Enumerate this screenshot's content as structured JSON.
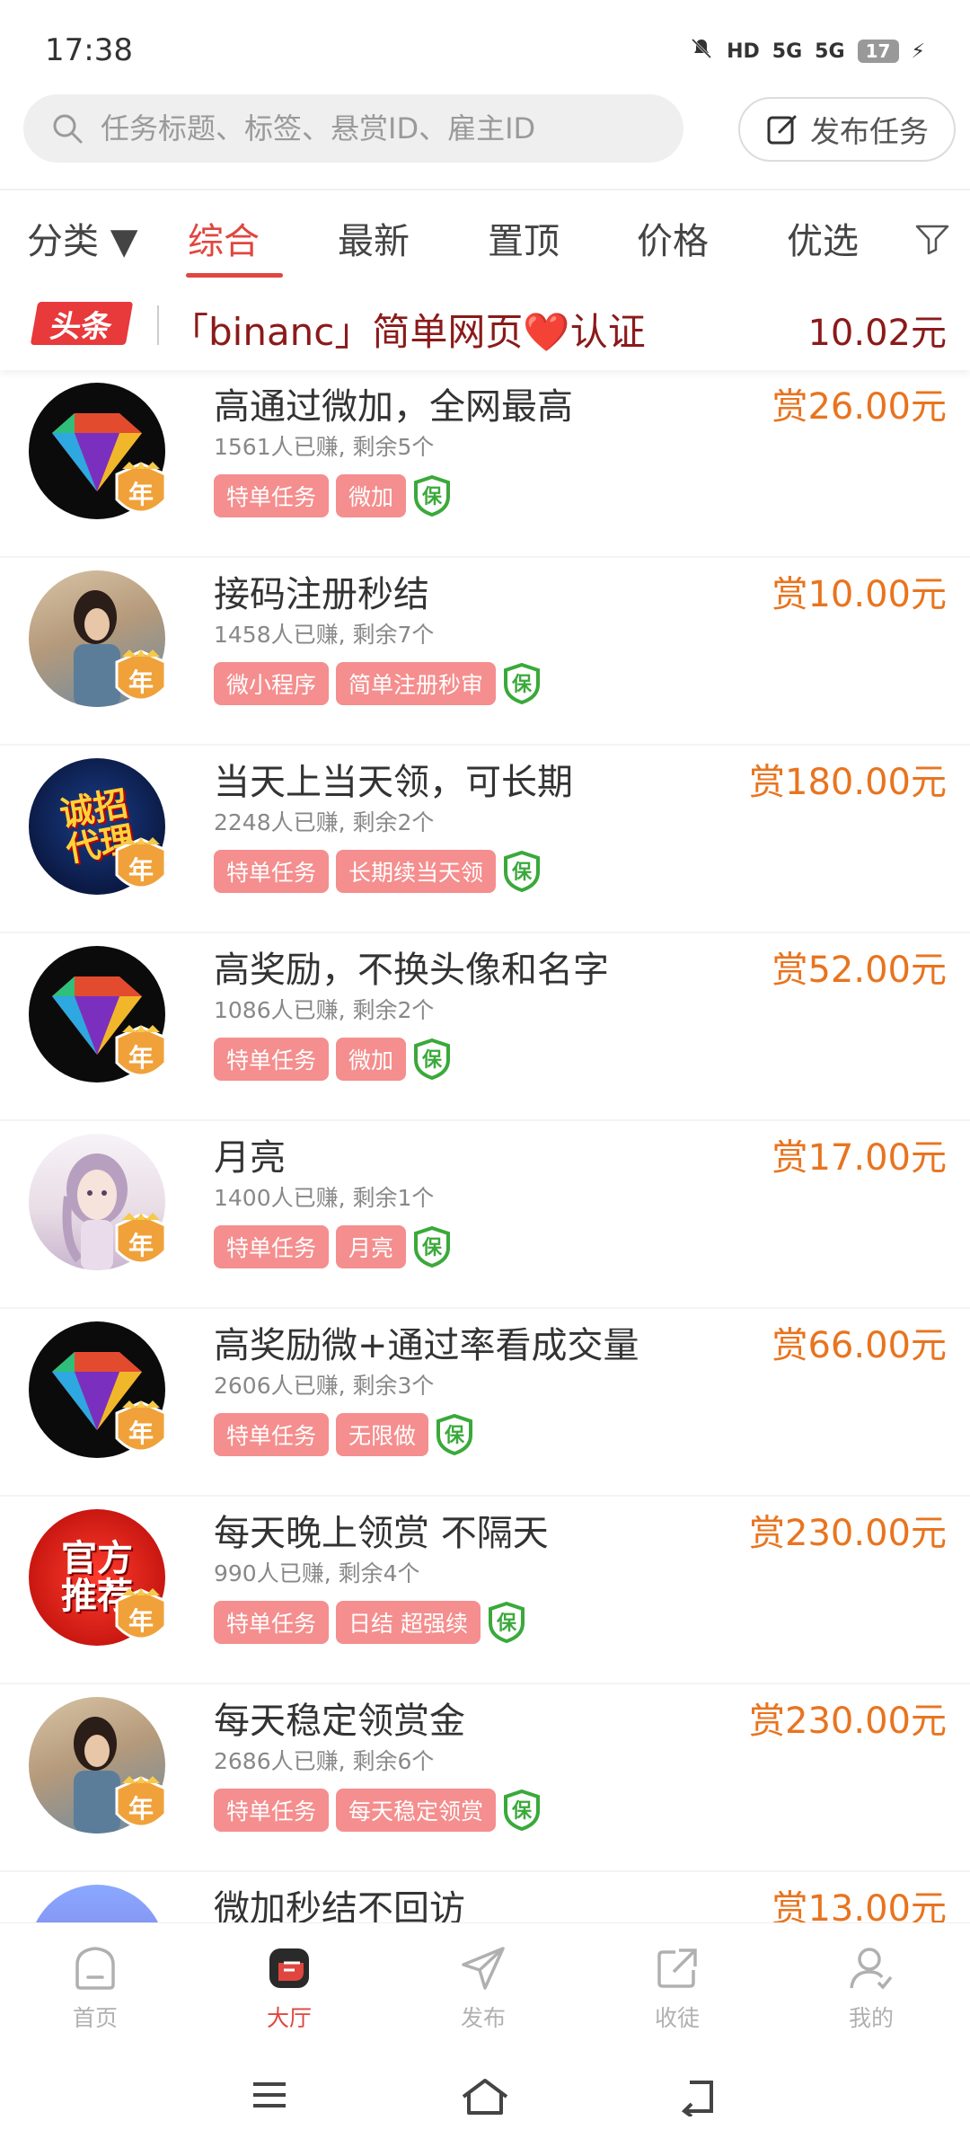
{
  "status_bar": {
    "time": "17:38",
    "icons": [
      "mute-icon",
      "hd-icon",
      "5g-signal-icon",
      "5g-signal-icon"
    ],
    "hd_label": "HD",
    "net1": "5G",
    "net2": "5G",
    "battery": "17"
  },
  "search": {
    "placeholder": "任务标题、标签、悬赏ID、雇主ID"
  },
  "publish_button": {
    "label": "发布任务"
  },
  "tabs": {
    "category": "分类 ▼",
    "items": [
      "综合",
      "最新",
      "置顶",
      "价格",
      "优选"
    ],
    "active": "综合"
  },
  "headline": {
    "badge": "头条",
    "text": "「binanc」简单网页❤️认证",
    "price": "10.02元"
  },
  "tasks": [
    {
      "title": "高通过微加，全网最高",
      "meta": "1561人已赚, 剩余5个",
      "tags": [
        "特单任务",
        "微加"
      ],
      "reward": "赏26.00元",
      "avatar": "diamond"
    },
    {
      "title": "接码注册秒结",
      "meta": "1458人已赚, 剩余7个",
      "tags": [
        "微小程序",
        "简单注册秒审"
      ],
      "reward": "赏10.00元",
      "avatar": "girl"
    },
    {
      "title": "当天上当天领，可长期",
      "meta": "2248人已赚, 剩余2个",
      "tags": [
        "特单任务",
        "长期续当天领"
      ],
      "reward": "赏180.00元",
      "avatar": "agent",
      "avatar_text": "诚招代理"
    },
    {
      "title": "高奖励，不换头像和名字",
      "meta": "1086人已赚, 剩余2个",
      "tags": [
        "特单任务",
        "微加"
      ],
      "reward": "赏52.00元",
      "avatar": "diamond"
    },
    {
      "title": "月亮",
      "meta": "1400人已赚, 剩余1个",
      "tags": [
        "特单任务",
        "月亮"
      ],
      "reward": "赏17.00元",
      "avatar": "anime"
    },
    {
      "title": "高奖励微+通过率看成交量",
      "meta": "2606人已赚, 剩余3个",
      "tags": [
        "特单任务",
        "无限做"
      ],
      "reward": "赏66.00元",
      "avatar": "diamond"
    },
    {
      "title": "每天晚上领赏 不隔天",
      "meta": "990人已赚, 剩余4个",
      "tags": [
        "特单任务",
        "日结 超强续"
      ],
      "reward": "赏230.00元",
      "avatar": "official",
      "avatar_text": "官方推荐"
    },
    {
      "title": "每天稳定领赏金",
      "meta": "2686人已赚, 剩余6个",
      "tags": [
        "特单任务",
        "每天稳定领赏"
      ],
      "reward": "赏230.00元",
      "avatar": "girl"
    },
    {
      "title": "微加秒结不回访",
      "meta": "",
      "tags": [],
      "reward": "赏13.00元",
      "avatar": "partial"
    }
  ],
  "badges": {
    "year": "年",
    "guarantee": "保"
  },
  "bottom_nav": [
    {
      "label": "首页",
      "icon": "home-icon"
    },
    {
      "label": "大厅",
      "icon": "hall-icon",
      "active": true
    },
    {
      "label": "发布",
      "icon": "send-icon"
    },
    {
      "label": "收徒",
      "icon": "share-icon"
    },
    {
      "label": "我的",
      "icon": "profile-icon"
    }
  ],
  "colors": {
    "accent": "#e0463f",
    "reward": "#e8741f",
    "tag": "#f58e8e",
    "headline_text": "#8b1a1a",
    "guarantee": "#3aa93a"
  }
}
